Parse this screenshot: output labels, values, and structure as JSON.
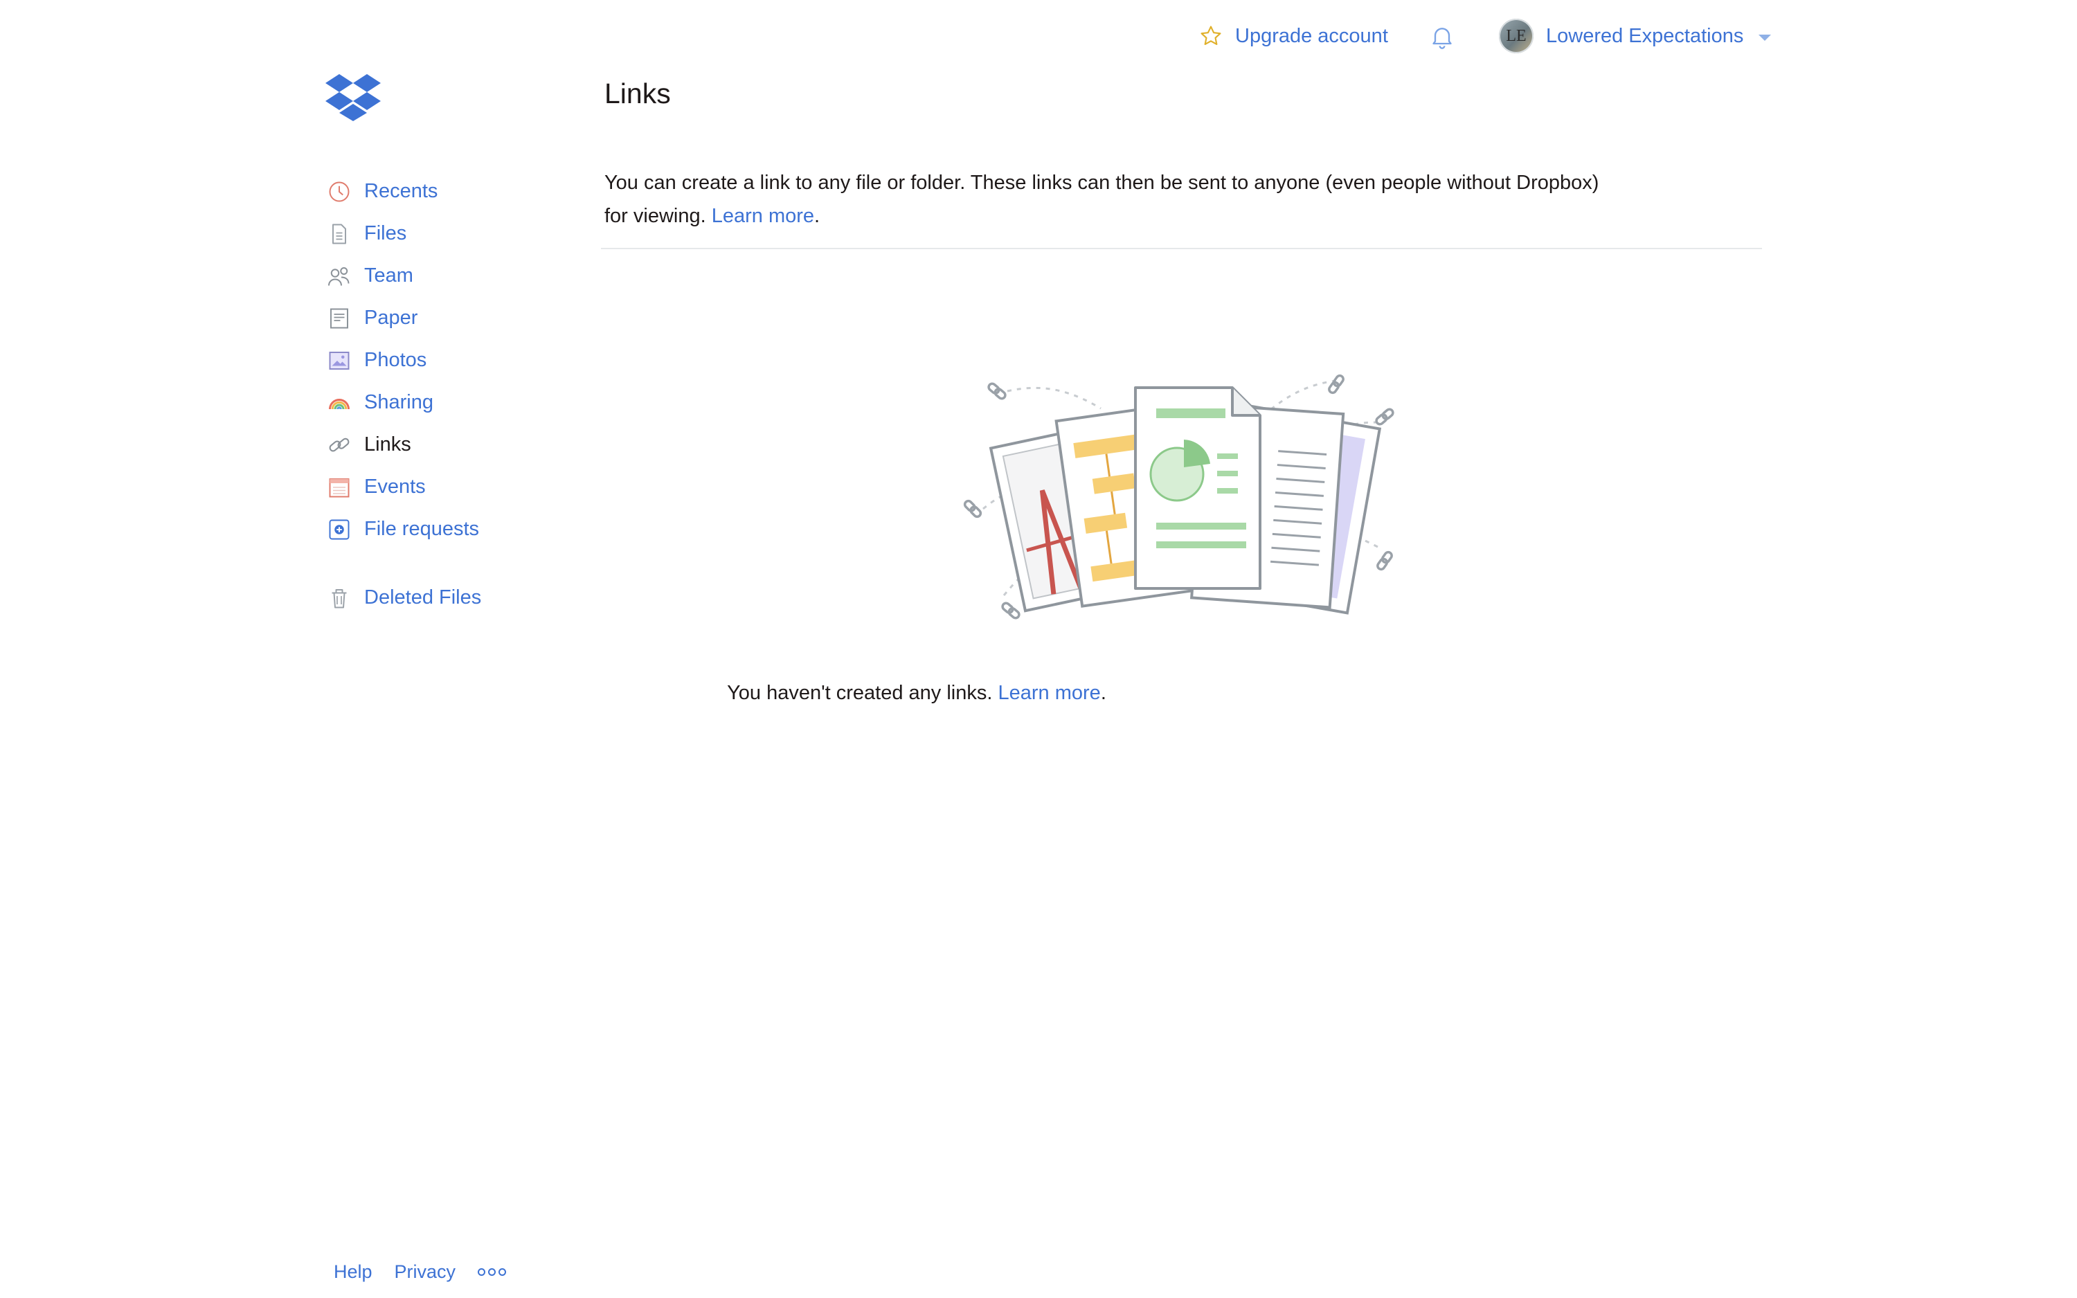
{
  "topbar": {
    "upgrade_label": "Upgrade account",
    "upgrade_icon": "star-icon",
    "notifications_icon": "bell-icon",
    "avatar_initials": "LE",
    "account_name": "Lowered Expectations"
  },
  "sidebar": {
    "items": [
      {
        "label": "Recents",
        "icon": "clock-icon"
      },
      {
        "label": "Files",
        "icon": "file-icon"
      },
      {
        "label": "Team",
        "icon": "team-icon"
      },
      {
        "label": "Paper",
        "icon": "paper-icon"
      },
      {
        "label": "Photos",
        "icon": "photos-icon"
      },
      {
        "label": "Sharing",
        "icon": "rainbow-icon"
      },
      {
        "label": "Links",
        "icon": "link-icon",
        "active": true
      },
      {
        "label": "Events",
        "icon": "calendar-icon"
      },
      {
        "label": "File requests",
        "icon": "file-request-icon"
      }
    ],
    "deleted_files": {
      "label": "Deleted Files",
      "icon": "trash-icon"
    }
  },
  "main": {
    "title": "Links",
    "description_line1": "You can create a link to any file or folder. These links can then be sent to anyone (even people without Dropbox)",
    "description_line2": "for viewing.",
    "description_link": "Learn more",
    "empty_text": "You haven't created any links.",
    "empty_link": "Learn more"
  },
  "footer": {
    "help": "Help",
    "privacy": "Privacy"
  },
  "colors": {
    "link": "#3d72d4",
    "text": "#1e1919",
    "divider": "#e6e8ea",
    "brand": "#0061fe"
  }
}
